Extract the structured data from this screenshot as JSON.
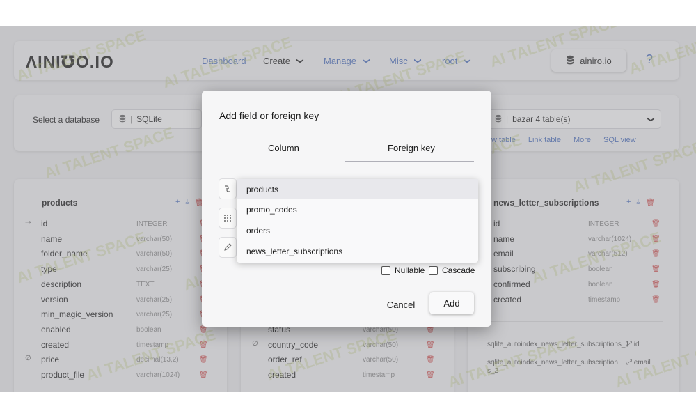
{
  "header": {
    "logo": "ΛINI℧O.IO",
    "nav": [
      {
        "label": "Dashboard",
        "chevron": false
      },
      {
        "label": "Create",
        "chevron": true
      },
      {
        "label": "Manage",
        "chevron": true
      },
      {
        "label": "Misc",
        "chevron": true
      },
      {
        "label": "root",
        "chevron": true
      }
    ],
    "chevron_glyph": "❯",
    "account_label": "ainiro.io",
    "help": "?"
  },
  "db": {
    "label": "Select a database",
    "selected": "SQLite",
    "table_selected": "bazar 4 table(s)",
    "links": [
      "w table",
      "Link table",
      "More",
      "SQL view"
    ]
  },
  "tables": {
    "products": {
      "title": "products",
      "columns": [
        {
          "name": "id",
          "type": "INTEGER",
          "icon": "key"
        },
        {
          "name": "name",
          "type": "varchar(50)",
          "icon": ""
        },
        {
          "name": "folder_name",
          "type": "varchar(50)",
          "icon": ""
        },
        {
          "name": "type",
          "type": "varchar(25)",
          "icon": ""
        },
        {
          "name": "description",
          "type": "TEXT",
          "icon": ""
        },
        {
          "name": "version",
          "type": "varchar(25)",
          "icon": ""
        },
        {
          "name": "min_magic_version",
          "type": "varchar(25)",
          "icon": ""
        },
        {
          "name": "enabled",
          "type": "boolean",
          "icon": ""
        },
        {
          "name": "created",
          "type": "timestamp",
          "icon": ""
        },
        {
          "name": "price",
          "type": "decimal(13,2)",
          "icon": "null"
        },
        {
          "name": "product_file",
          "type": "varchar(1024)",
          "icon": ""
        }
      ]
    },
    "orders": {
      "columns": [
        {
          "name": "status",
          "type": "varchar(50)",
          "icon": ""
        },
        {
          "name": "country_code",
          "type": "varchar(50)",
          "icon": "null"
        },
        {
          "name": "order_ref",
          "type": "varchar(50)",
          "icon": ""
        },
        {
          "name": "created",
          "type": "timestamp",
          "icon": ""
        }
      ]
    },
    "newsletter": {
      "title": "news_letter_subscriptions",
      "columns": [
        {
          "name": "id",
          "type": "INTEGER"
        },
        {
          "name": "name",
          "type": "varchar(1024)"
        },
        {
          "name": "email",
          "type": "varchar(512)"
        },
        {
          "name": "subscribing",
          "type": "boolean"
        },
        {
          "name": "confirmed",
          "type": "boolean"
        },
        {
          "name": "created",
          "type": "timestamp"
        }
      ],
      "indexes": [
        {
          "name": "sqlite_autoindex_news_letter_subscriptions_1",
          "col": "id"
        },
        {
          "name": "sqlite_autoindex_news_letter_subscriptions_2",
          "col": "email"
        }
      ]
    }
  },
  "modal": {
    "title": "Add field or foreign key",
    "tabs": [
      "Column",
      "Foreign key"
    ],
    "options": [
      "products",
      "promo_codes",
      "orders",
      "news_letter_subscriptions"
    ],
    "nullable": "Nullable",
    "cascade": "Cascade",
    "cancel": "Cancel",
    "add": "Add"
  },
  "watermark_text": "AI TALENT SPACE",
  "icons": {
    "database": "database-icon",
    "link": "link-icon",
    "grid": "grid-icon",
    "pencil": "pencil-icon",
    "trash": "trash-icon",
    "plus": "plus-icon",
    "download": "download-icon"
  }
}
